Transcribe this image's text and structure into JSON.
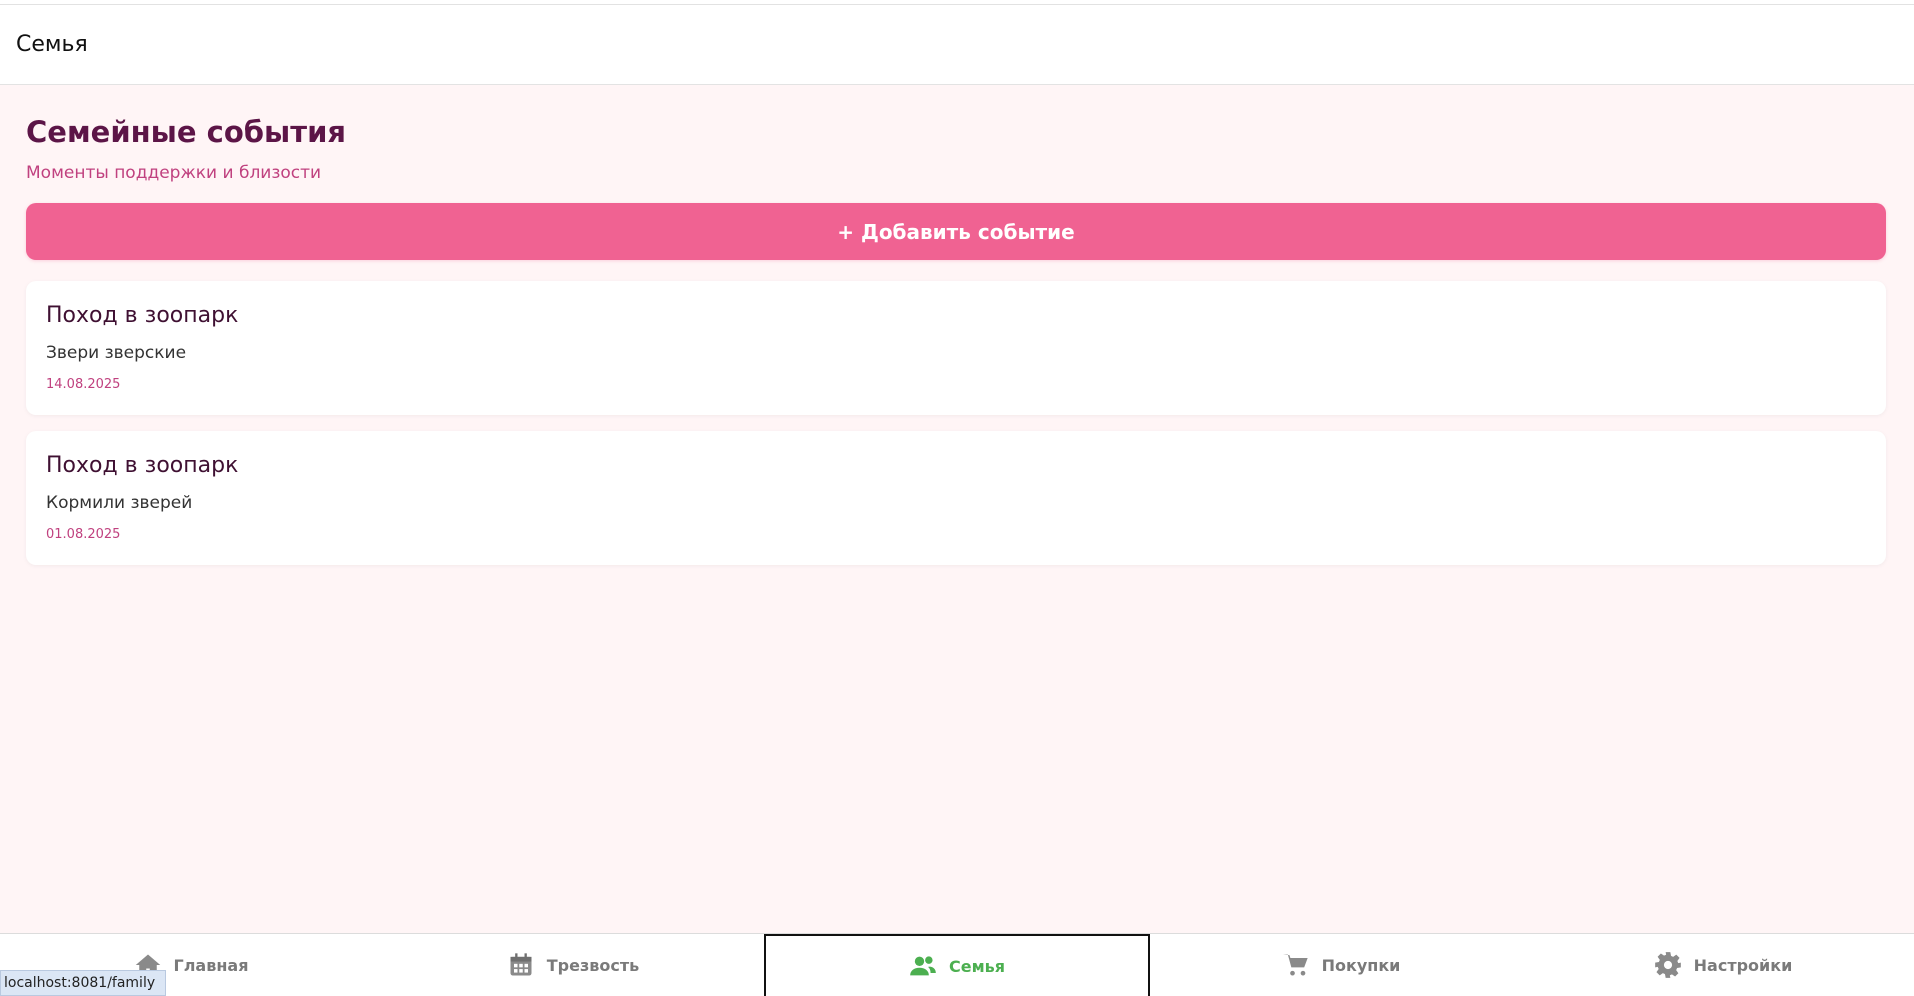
{
  "header": {
    "title": "Семья"
  },
  "page": {
    "title": "Семейные события",
    "subtitle": "Моменты поддержки и близости",
    "add_button_label": "+ Добавить событие"
  },
  "events": [
    {
      "title": "Поход в зоопарк",
      "description": "Звери зверские",
      "date": "14.08.2025"
    },
    {
      "title": "Поход в зоопарк",
      "description": "Кормили зверей",
      "date": "01.08.2025"
    }
  ],
  "tabbar": {
    "tabs": [
      {
        "label": "Главная",
        "icon": "home-icon"
      },
      {
        "label": "Трезвость",
        "icon": "calendar-icon"
      },
      {
        "label": "Семья",
        "icon": "users-icon",
        "active": true
      },
      {
        "label": "Покупки",
        "icon": "cart-icon"
      },
      {
        "label": "Настройки",
        "icon": "gear-icon"
      }
    ]
  },
  "status_bar": {
    "url": "localhost:8081/family"
  },
  "colors": {
    "accent": "#f06292",
    "title": "#5c1547",
    "subtitle": "#c0417f",
    "background": "#fff5f6",
    "active_tab": "#4caf50",
    "inactive_tab": "#7a7a7a"
  }
}
